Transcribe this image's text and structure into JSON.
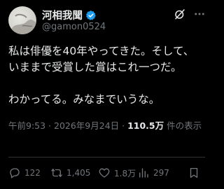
{
  "author": {
    "display_name": "河相我聞",
    "handle": "@gamon0524",
    "verified": true,
    "avatar_icon": "avatar-photo"
  },
  "tweet": {
    "lines": [
      "私は俳優を40年やってきた。そして、",
      "いままで受賞した賞はこれ一つだ。",
      "",
      "わかってる。みなまでいうな。"
    ]
  },
  "meta": {
    "timestamp": "午前9:53 · 2026年9月24日 · ",
    "views": "110.5万",
    "views_suffix": " 件の表示"
  },
  "actions": {
    "reply_count": "122",
    "repost_count": "1,405",
    "like_count": "1.8万",
    "view_count": "297"
  },
  "colors": {
    "background": "#000000",
    "text": "#e7e9ea",
    "muted": "#71767b",
    "verified": "#1d9bf0",
    "divider": "#2f3336"
  }
}
